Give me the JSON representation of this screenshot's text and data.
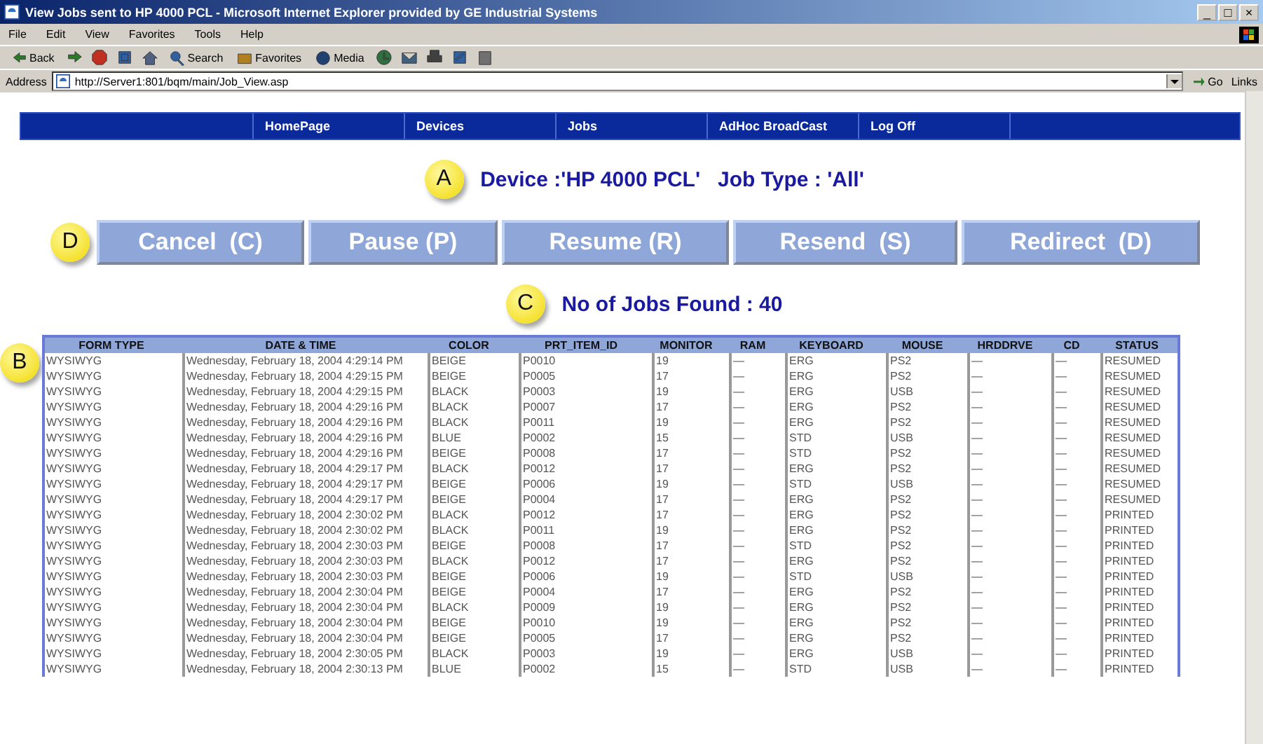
{
  "window": {
    "title": "View Jobs sent to HP 4000 PCL - Microsoft Internet Explorer provided by GE Industrial Systems",
    "controls": [
      "_",
      "□",
      "×"
    ]
  },
  "menu": [
    "File",
    "Edit",
    "View",
    "Favorites",
    "Tools",
    "Help"
  ],
  "toolbar": [
    {
      "kind": "text",
      "label": "Back"
    },
    {
      "kind": "icon"
    },
    {
      "kind": "icon"
    },
    {
      "kind": "icon"
    },
    {
      "kind": "icon"
    },
    {
      "kind": "text",
      "label": "Search"
    },
    {
      "kind": "text",
      "label": "Favorites"
    },
    {
      "kind": "text",
      "label": "Media"
    },
    {
      "kind": "icon"
    },
    {
      "kind": "icon"
    },
    {
      "kind": "icon"
    },
    {
      "kind": "icon"
    },
    {
      "kind": "icon"
    }
  ],
  "address": {
    "label": "Address",
    "url": "http://Server1:801/bqm/main/Job_View.asp",
    "go": "Go",
    "links": "Links"
  },
  "nav": [
    "HomePage",
    "Devices",
    "Jobs",
    "AdHoc BroadCast",
    "Log Off"
  ],
  "heading": {
    "callout": "A",
    "text": "Device :'HP 4000 PCL'   Job Type : 'All'"
  },
  "actions": {
    "callout": "D",
    "buttons": [
      "Cancel  (C)",
      "Pause (P)",
      "Resume (R)",
      "Resend  (S)",
      "Redirect  (D)"
    ]
  },
  "found": {
    "callout": "C",
    "text": "No of Jobs Found : 40"
  },
  "table": {
    "callout": "B",
    "columns": [
      "FORM TYPE",
      "DATE & TIME",
      "COLOR",
      "PRT_ITEM_ID",
      "MONITOR",
      "RAM",
      "KEYBOARD",
      "MOUSE",
      "HRDDRVE",
      "CD",
      "STATUS"
    ],
    "rows": [
      [
        "WYSIWYG",
        "Wednesday, February 18, 2004 4:29:14 PM",
        "BEIGE",
        "P0010",
        "19",
        "—",
        "ERG",
        "PS2",
        "—",
        "—",
        "RESUMED"
      ],
      [
        "WYSIWYG",
        "Wednesday, February 18, 2004 4:29:15 PM",
        "BEIGE",
        "P0005",
        "17",
        "—",
        "ERG",
        "PS2",
        "—",
        "—",
        "RESUMED"
      ],
      [
        "WYSIWYG",
        "Wednesday, February 18, 2004 4:29:15 PM",
        "BLACK",
        "P0003",
        "19",
        "—",
        "ERG",
        "USB",
        "—",
        "—",
        "RESUMED"
      ],
      [
        "WYSIWYG",
        "Wednesday, February 18, 2004 4:29:16 PM",
        "BLACK",
        "P0007",
        "17",
        "—",
        "ERG",
        "PS2",
        "—",
        "—",
        "RESUMED"
      ],
      [
        "WYSIWYG",
        "Wednesday, February 18, 2004 4:29:16 PM",
        "BLACK",
        "P0011",
        "19",
        "—",
        "ERG",
        "PS2",
        "—",
        "—",
        "RESUMED"
      ],
      [
        "WYSIWYG",
        "Wednesday, February 18, 2004 4:29:16 PM",
        "BLUE",
        "P0002",
        "15",
        "—",
        "STD",
        "USB",
        "—",
        "—",
        "RESUMED"
      ],
      [
        "WYSIWYG",
        "Wednesday, February 18, 2004 4:29:16 PM",
        "BEIGE",
        "P0008",
        "17",
        "—",
        "STD",
        "PS2",
        "—",
        "—",
        "RESUMED"
      ],
      [
        "WYSIWYG",
        "Wednesday, February 18, 2004 4:29:17 PM",
        "BLACK",
        "P0012",
        "17",
        "—",
        "ERG",
        "PS2",
        "—",
        "—",
        "RESUMED"
      ],
      [
        "WYSIWYG",
        "Wednesday, February 18, 2004 4:29:17 PM",
        "BEIGE",
        "P0006",
        "19",
        "—",
        "STD",
        "USB",
        "—",
        "—",
        "RESUMED"
      ],
      [
        "WYSIWYG",
        "Wednesday, February 18, 2004 4:29:17 PM",
        "BEIGE",
        "P0004",
        "17",
        "—",
        "ERG",
        "PS2",
        "—",
        "—",
        "RESUMED"
      ],
      [
        "WYSIWYG",
        "Wednesday, February 18, 2004 2:30:02 PM",
        "BLACK",
        "P0012",
        "17",
        "—",
        "ERG",
        "PS2",
        "—",
        "—",
        "PRINTED"
      ],
      [
        "WYSIWYG",
        "Wednesday, February 18, 2004 2:30:02 PM",
        "BLACK",
        "P0011",
        "19",
        "—",
        "ERG",
        "PS2",
        "—",
        "—",
        "PRINTED"
      ],
      [
        "WYSIWYG",
        "Wednesday, February 18, 2004 2:30:03 PM",
        "BEIGE",
        "P0008",
        "17",
        "—",
        "STD",
        "PS2",
        "—",
        "—",
        "PRINTED"
      ],
      [
        "WYSIWYG",
        "Wednesday, February 18, 2004 2:30:03 PM",
        "BLACK",
        "P0012",
        "17",
        "—",
        "ERG",
        "PS2",
        "—",
        "—",
        "PRINTED"
      ],
      [
        "WYSIWYG",
        "Wednesday, February 18, 2004 2:30:03 PM",
        "BEIGE",
        "P0006",
        "19",
        "—",
        "STD",
        "USB",
        "—",
        "—",
        "PRINTED"
      ],
      [
        "WYSIWYG",
        "Wednesday, February 18, 2004 2:30:04 PM",
        "BEIGE",
        "P0004",
        "17",
        "—",
        "ERG",
        "PS2",
        "—",
        "—",
        "PRINTED"
      ],
      [
        "WYSIWYG",
        "Wednesday, February 18, 2004 2:30:04 PM",
        "BLACK",
        "P0009",
        "19",
        "—",
        "ERG",
        "PS2",
        "—",
        "—",
        "PRINTED"
      ],
      [
        "WYSIWYG",
        "Wednesday, February 18, 2004 2:30:04 PM",
        "BEIGE",
        "P0010",
        "19",
        "—",
        "ERG",
        "PS2",
        "—",
        "—",
        "PRINTED"
      ],
      [
        "WYSIWYG",
        "Wednesday, February 18, 2004 2:30:04 PM",
        "BEIGE",
        "P0005",
        "17",
        "—",
        "ERG",
        "PS2",
        "—",
        "—",
        "PRINTED"
      ],
      [
        "WYSIWYG",
        "Wednesday, February 18, 2004 2:30:05 PM",
        "BLACK",
        "P0003",
        "19",
        "—",
        "ERG",
        "USB",
        "—",
        "—",
        "PRINTED"
      ],
      [
        "WYSIWYG",
        "Wednesday, February 18, 2004 2:30:13 PM",
        "BLUE",
        "P0002",
        "15",
        "—",
        "STD",
        "USB",
        "—",
        "—",
        "PRINTED"
      ]
    ]
  }
}
